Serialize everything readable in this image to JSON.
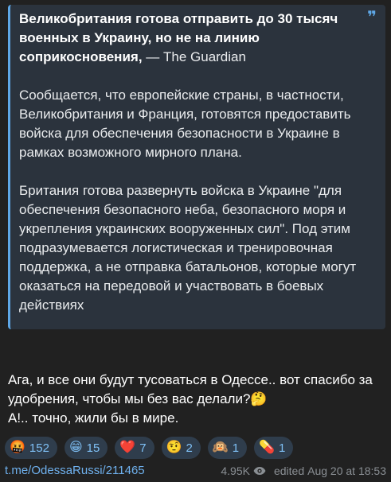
{
  "quote": {
    "headline": "Великобритания готова отправить до 30 тысяч военных в Украину, но не на линию соприкосновения,",
    "source": " — The Guardian",
    "paragraph1": "Сообщается, что европейские страны, в частности, Великобритания и Франция, готовятся предоставить войска для обеспечения безопасности в Украине в рамках возможного мирного плана.",
    "paragraph2": "Британия готова развернуть войска в Украине \"для обеспечения безопасного неба, безопасного моря и укрепления украинских вооруженных сил\". Под этим подразумевается логистическая и тренировочная поддержка, а не отправка батальонов, которые могут оказаться на передовой и участвовать в боевых действиях",
    "quote_mark": "❞"
  },
  "message": {
    "line1": "Ага, и все они будут тусоваться в Одессе.. вот спасибо за удобрения, чтобы мы без вас делали?🤔",
    "line2": "А!.. точно, жили бы в мире."
  },
  "reactions": [
    {
      "emoji": "🤬",
      "count": "152"
    },
    {
      "emoji": "😁",
      "count": "15"
    },
    {
      "emoji": "❤️",
      "count": "7"
    },
    {
      "emoji": "🤨",
      "count": "2"
    },
    {
      "emoji": "🙉",
      "count": "1"
    },
    {
      "emoji": "💊",
      "count": "1"
    }
  ],
  "footer": {
    "link": "t.me/OdessaRussi/211465",
    "views": "4.95K",
    "edited": "edited",
    "timestamp": "Aug 20 at 18:53"
  },
  "colors": {
    "background": "#212121",
    "quote_bg": "#2b333d",
    "accent": "#5ea7e6",
    "link": "#6fb1ee",
    "reaction_bg": "#2f3d4c",
    "meta": "#8a8f94"
  },
  "icons": {
    "views": "eye-icon",
    "quote": "quote-mark-icon"
  }
}
